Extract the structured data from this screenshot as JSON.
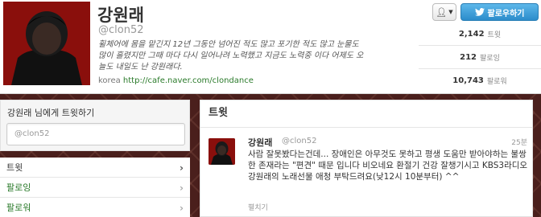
{
  "profile": {
    "name": "강원래",
    "handle": "@clon52",
    "bio": "휠체어에 몸을 맡긴지 12년 그동안 넘어진 적도 많고 포기한 적도 많고 눈물도 많이 흘렸지만 그때 마다 다시 일어나려 노력했고 지금도 노력중 이다 어제도 오늘도 내일도 난 강원래다.",
    "location": "korea",
    "url": "http://cafe.naver.com/clondance"
  },
  "actions": {
    "follow_label": "팔로우하기"
  },
  "stats": [
    {
      "value": "2,142",
      "label": "트윗"
    },
    {
      "value": "212",
      "label": "팔로잉"
    },
    {
      "value": "10,743",
      "label": "팔로워"
    }
  ],
  "tweet_to": {
    "title": "강원래 님에게 트윗하기",
    "placeholder": "@clon52"
  },
  "nav": [
    {
      "label": "트윗"
    },
    {
      "label": "팔로잉"
    },
    {
      "label": "팔로워"
    }
  ],
  "stream": {
    "title": "트윗",
    "tweets": [
      {
        "name": "강원래",
        "handle": "@clon52",
        "time": "25분",
        "text": "사람 잘못봤다는건데... 장애인은 아무것도 못하고 평생 도움만 받아야하는 불쌍한 존재라는 \"편견\" 때문 입니다 비오네요 환절기 건강 잘챙기시고 KBS3라디오 강원래의 노래선물 애청 부탁드려요(낮12시 10분부터) ^^",
        "expand_label": "펼치기"
      }
    ]
  },
  "colors": {
    "background": "#4a1f1c",
    "follow_button": "#2c8ccb",
    "link_green": "#2a7a2a",
    "avatar_red": "#8a0f0c"
  }
}
